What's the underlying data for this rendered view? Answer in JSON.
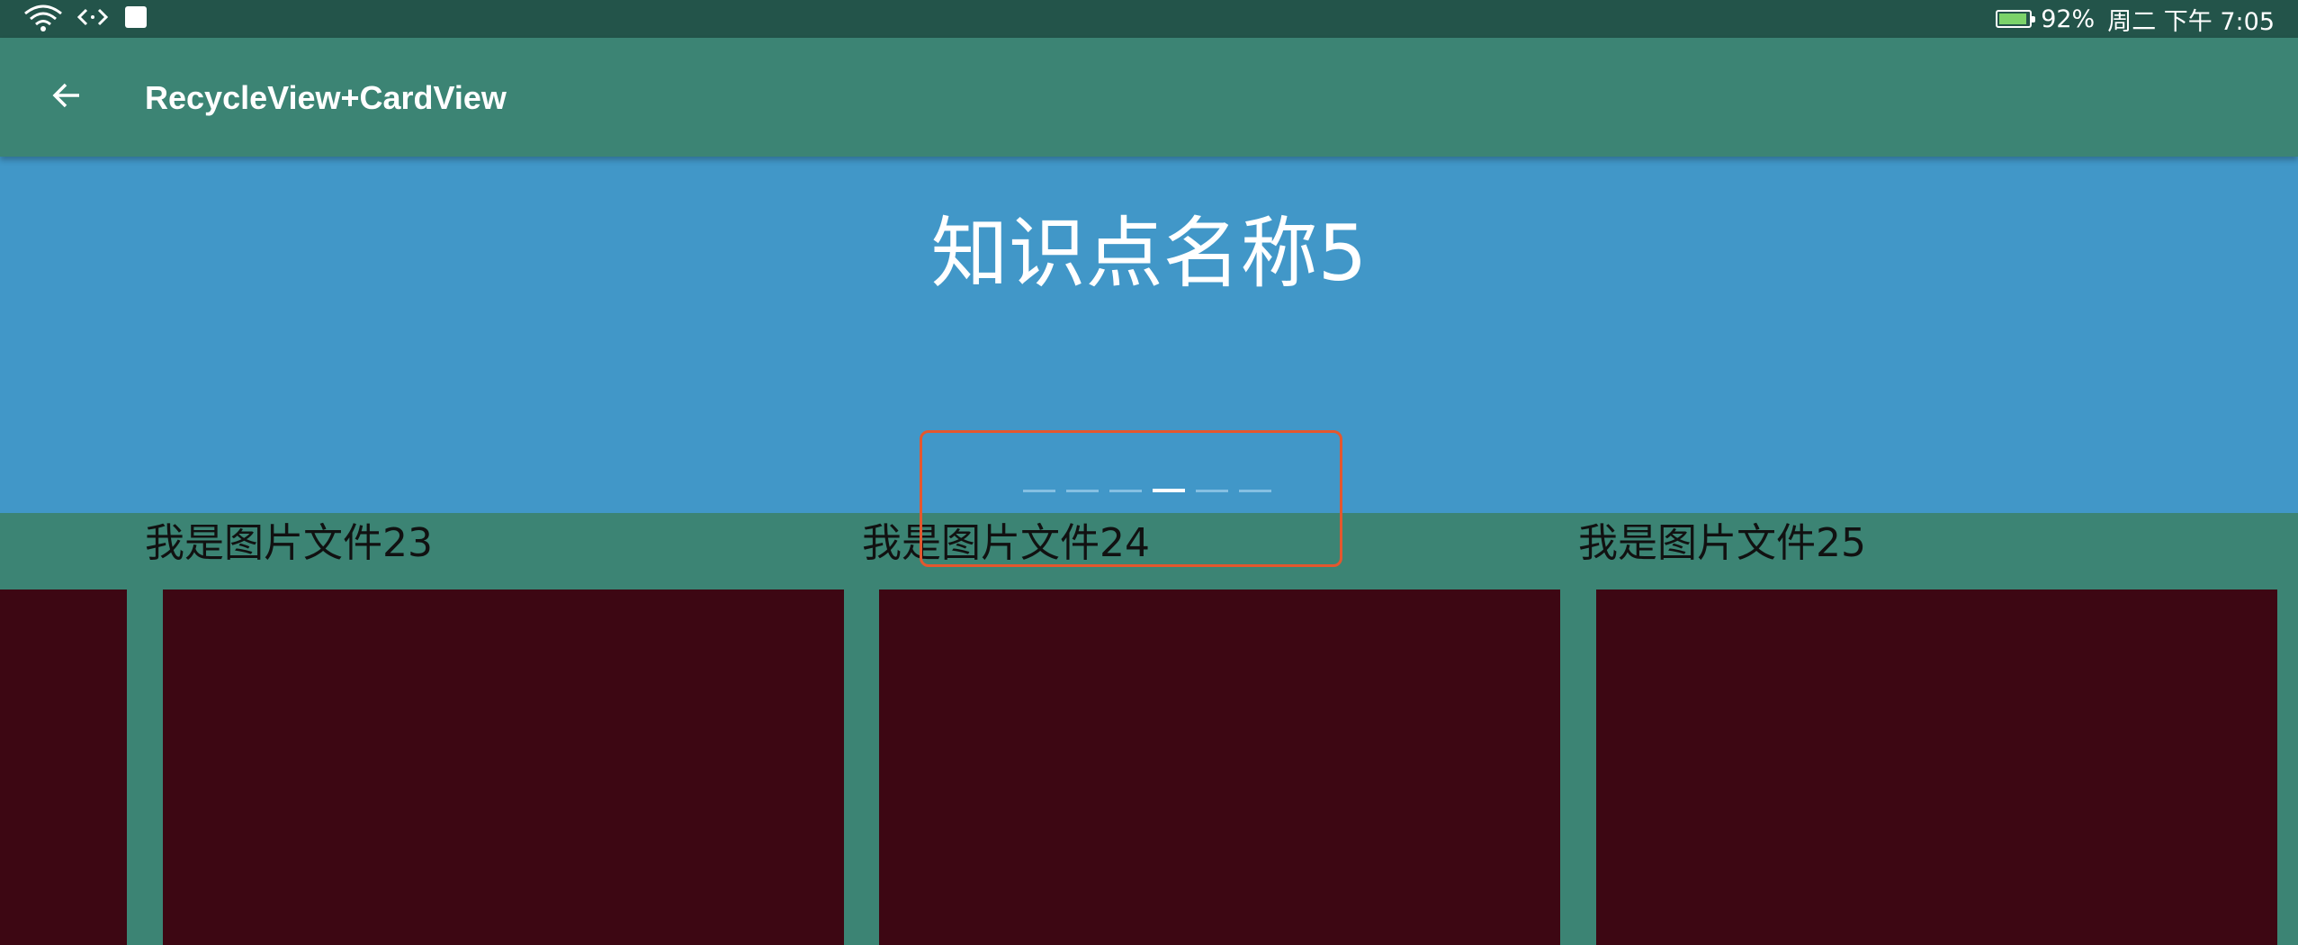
{
  "status_bar": {
    "battery_percent": 92,
    "battery_text": "92%",
    "datetime_text": "周二 下午 7:05",
    "icons": [
      "wifi-icon",
      "code-icon",
      "notification-square-icon",
      "battery-charging-icon"
    ]
  },
  "toolbar": {
    "title": "RecycleView+CardView",
    "back_icon": "arrow-left-icon"
  },
  "banner": {
    "title": "知识点名称5",
    "page_count": 6,
    "active_index": 3
  },
  "cards": [
    {
      "label": "我是图片文件23"
    },
    {
      "label": "我是图片文件24"
    },
    {
      "label": "我是图片文件25"
    }
  ],
  "colors": {
    "status_bar": "#23544a",
    "toolbar": "#3c8474",
    "banner": "#4197c8",
    "card_image": "#3d0713",
    "highlight": "#e4572e"
  }
}
